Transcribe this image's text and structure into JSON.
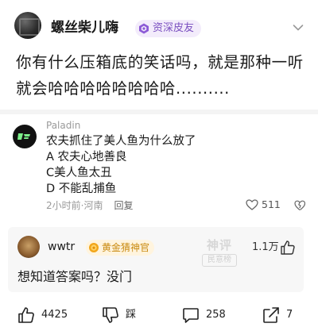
{
  "post": {
    "author": "螺丝柴儿嗨",
    "rank_badge": "资深皮友",
    "body": "你有什么压箱底的笑话吗，就是那种一听就会哈哈哈哈哈哈哈哈..........",
    "menu_icon": "chevron-down-icon"
  },
  "comment": {
    "author": "Paladin",
    "lines": [
      "农夫抓住了美人鱼为什么放了",
      "A 农夫心地善良",
      "C美人鱼太丑",
      "D 不能乱捕鱼"
    ],
    "time": "2小时前",
    "location": "河南",
    "reply_label": "回复",
    "like_count": "511"
  },
  "hot_comment": {
    "author": "wwtr",
    "badge": "黄金猜神官",
    "stamp_main": "神评",
    "stamp_sub": "民意榜",
    "like_count": "1.1万",
    "text": "想知道答案吗？没门"
  },
  "actions": {
    "like_count": "4425",
    "dislike_label": "踩",
    "comment_count": "258",
    "share_count": "7"
  },
  "colors": {
    "accent_purple": "#7a4fc0",
    "gold": "#c98a10",
    "meta_gray": "#999999"
  }
}
